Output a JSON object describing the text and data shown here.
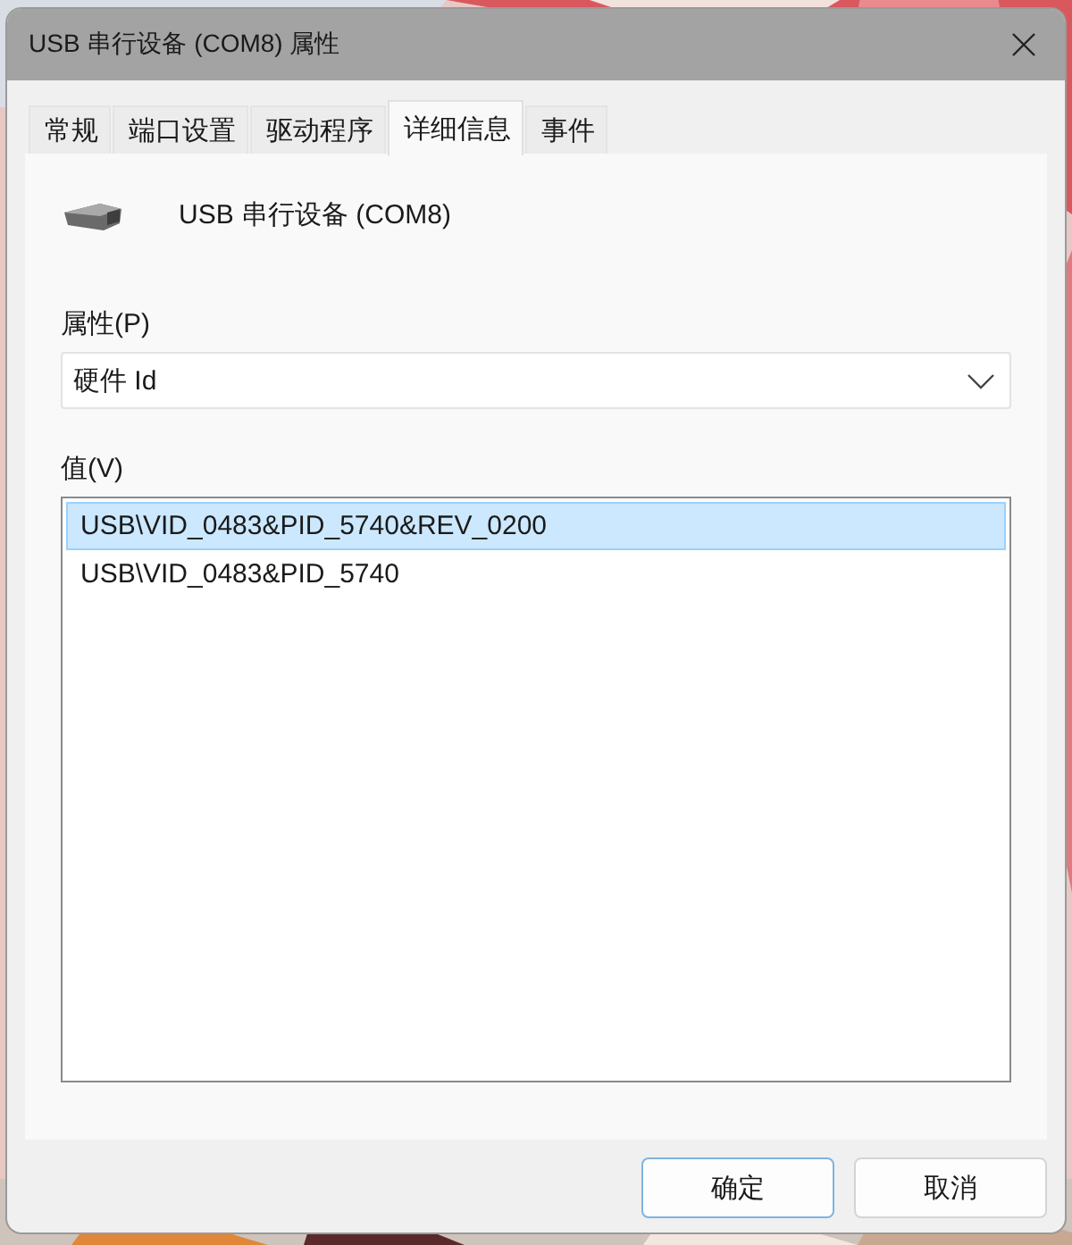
{
  "window": {
    "title": "USB 串行设备 (COM8) 属性"
  },
  "tabs": [
    {
      "label": "常规",
      "selected": false
    },
    {
      "label": "端口设置",
      "selected": false
    },
    {
      "label": "驱动程序",
      "selected": false
    },
    {
      "label": "详细信息",
      "selected": true
    },
    {
      "label": "事件",
      "selected": false
    }
  ],
  "device": {
    "name": "USB 串行设备 (COM8)"
  },
  "property": {
    "label": "属性(P)",
    "value": "硬件 Id"
  },
  "values": {
    "label": "值(V)",
    "items": [
      {
        "text": "USB\\VID_0483&PID_5740&REV_0200",
        "selected": true
      },
      {
        "text": "USB\\VID_0483&PID_5740",
        "selected": false
      }
    ]
  },
  "buttons": [
    {
      "label": "确定",
      "default": true
    },
    {
      "label": "取消",
      "default": false
    }
  ]
}
